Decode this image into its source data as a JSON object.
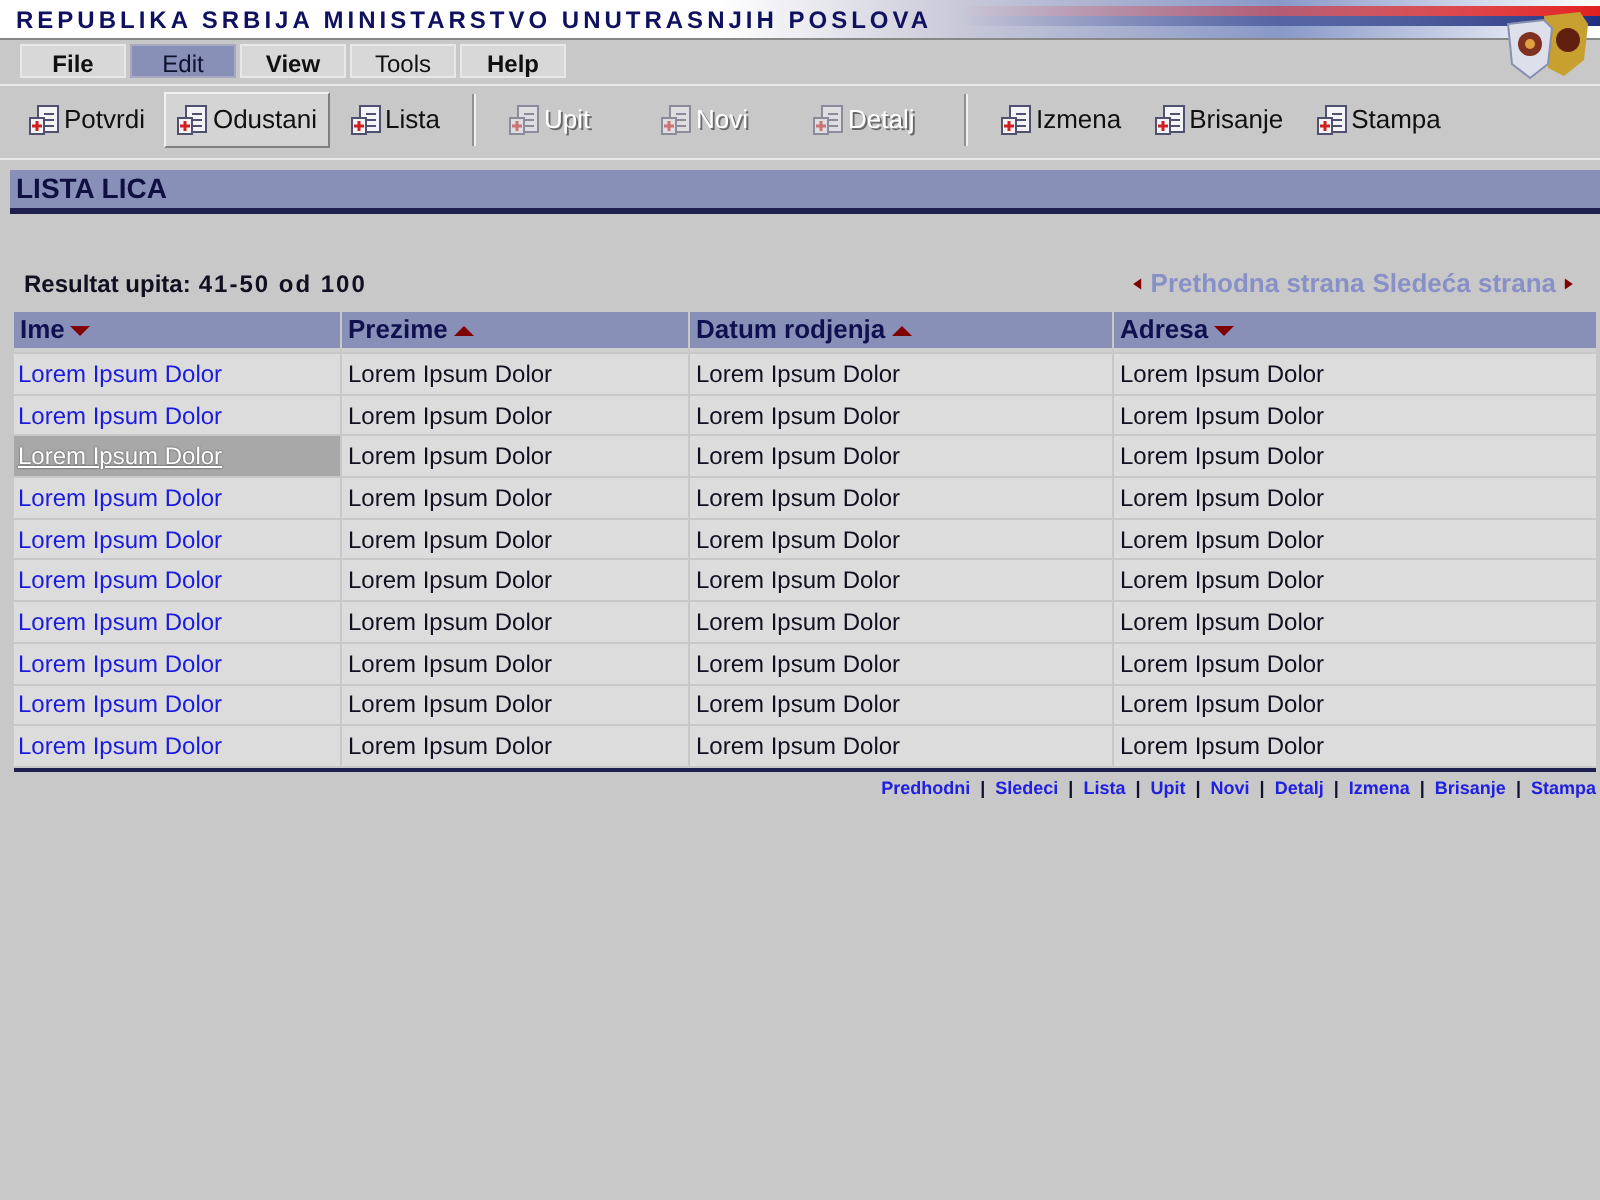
{
  "window": {
    "title": "REPUBLIKA SRBIJA MINISTARSTVO UNUTRASNJIH POSLOVA"
  },
  "menu": [
    {
      "label": "File",
      "selected": false,
      "bold": true
    },
    {
      "label": "Edit",
      "selected": true,
      "bold": false
    },
    {
      "label": "View",
      "selected": false,
      "bold": true
    },
    {
      "label": "Tools",
      "selected": false,
      "bold": false
    },
    {
      "label": "Help",
      "selected": false,
      "bold": true
    }
  ],
  "toolbar": [
    {
      "kind": "button",
      "label": "Potvrdi",
      "disabled": false,
      "pressed": false
    },
    {
      "kind": "button",
      "label": "Odustani",
      "disabled": false,
      "pressed": true
    },
    {
      "kind": "button",
      "label": "Lista",
      "disabled": false,
      "pressed": false
    },
    {
      "kind": "separator"
    },
    {
      "kind": "button",
      "label": "Upit",
      "disabled": true,
      "pressed": false
    },
    {
      "kind": "button",
      "label": "Novi",
      "disabled": true,
      "pressed": false
    },
    {
      "kind": "button",
      "label": "Detalj",
      "disabled": true,
      "pressed": false
    },
    {
      "kind": "separator"
    },
    {
      "kind": "button",
      "label": "Izmena",
      "disabled": false,
      "pressed": false
    },
    {
      "kind": "button",
      "label": "Brisanje",
      "disabled": false,
      "pressed": false
    },
    {
      "kind": "button",
      "label": "Stampa",
      "disabled": false,
      "pressed": false
    }
  ],
  "section_title": "LISTA LICA",
  "result_label": "Resultat upita:",
  "result_range": "41-50 od 100",
  "pager": {
    "previous": "Prethodna strana",
    "next": "Sledeća strana"
  },
  "table": {
    "columns": [
      {
        "label": "Ime",
        "sort_ascending": false
      },
      {
        "label": "Prezime",
        "sort_ascending": true
      },
      {
        "label": "Datum rodjenja",
        "sort_ascending": true
      },
      {
        "label": "Adresa",
        "sort_ascending": false
      }
    ],
    "rows": [
      {
        "selected": false,
        "cells": [
          "Lorem Ipsum Dolor",
          "Lorem Ipsum Dolor",
          "Lorem Ipsum Dolor",
          "Lorem Ipsum Dolor"
        ]
      },
      {
        "selected": false,
        "cells": [
          "Lorem Ipsum Dolor",
          "Lorem Ipsum Dolor",
          "Lorem Ipsum Dolor",
          "Lorem Ipsum Dolor"
        ]
      },
      {
        "selected": true,
        "cells": [
          "Lorem Ipsum Dolor",
          "Lorem Ipsum Dolor",
          "Lorem Ipsum Dolor",
          "Lorem Ipsum Dolor"
        ]
      },
      {
        "selected": false,
        "cells": [
          "Lorem Ipsum Dolor",
          "Lorem Ipsum Dolor",
          "Lorem Ipsum Dolor",
          "Lorem Ipsum Dolor"
        ]
      },
      {
        "selected": false,
        "cells": [
          "Lorem Ipsum Dolor",
          "Lorem Ipsum Dolor",
          "Lorem Ipsum Dolor",
          "Lorem Ipsum Dolor"
        ]
      },
      {
        "selected": false,
        "cells": [
          "Lorem Ipsum Dolor",
          "Lorem Ipsum Dolor",
          "Lorem Ipsum Dolor",
          "Lorem Ipsum Dolor"
        ]
      },
      {
        "selected": false,
        "cells": [
          "Lorem Ipsum Dolor",
          "Lorem Ipsum Dolor",
          "Lorem Ipsum Dolor",
          "Lorem Ipsum Dolor"
        ]
      },
      {
        "selected": false,
        "cells": [
          "Lorem Ipsum Dolor",
          "Lorem Ipsum Dolor",
          "Lorem Ipsum Dolor",
          "Lorem Ipsum Dolor"
        ]
      },
      {
        "selected": false,
        "cells": [
          "Lorem Ipsum Dolor",
          "Lorem Ipsum Dolor",
          "Lorem Ipsum Dolor",
          "Lorem Ipsum Dolor"
        ]
      },
      {
        "selected": false,
        "cells": [
          "Lorem Ipsum Dolor",
          "Lorem Ipsum Dolor",
          "Lorem Ipsum Dolor",
          "Lorem Ipsum Dolor"
        ]
      }
    ]
  },
  "footer_links": [
    "Predhodni",
    "Sledeci",
    "Lista",
    "Upit",
    "Novi",
    "Detalj",
    "Izmena",
    "Brisanje",
    "Stampa"
  ],
  "footer_separator": "|"
}
